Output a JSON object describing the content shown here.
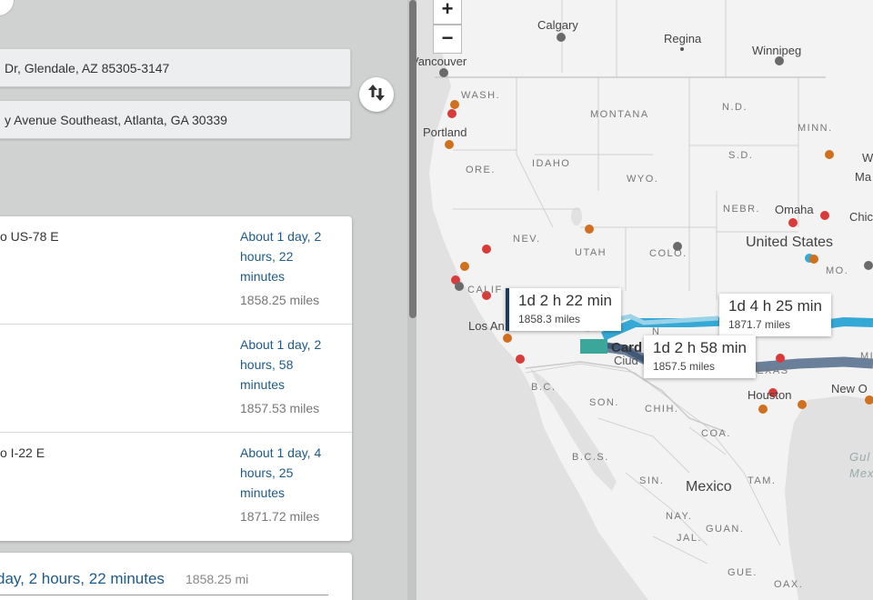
{
  "origin": {
    "value": "Dr, Glendale, AZ 85305-3147"
  },
  "destination": {
    "value": "y Avenue Southeast, Atlanta, GA 30339"
  },
  "routes": [
    {
      "name": "o US-78 E",
      "time": "About 1 day, 2 hours, 22 minutes",
      "distance": "1858.25 miles"
    },
    {
      "name": "",
      "time": "About 1 day, 2 hours, 58 minutes",
      "distance": "1857.53 miles"
    },
    {
      "name": "o I-22 E",
      "time": "About 1 day, 4 hours, 25 minutes",
      "distance": "1871.72 miles"
    }
  ],
  "summary": {
    "time": "day, 2 hours, 22 minutes",
    "distance": "1858.25 mi"
  },
  "zoom": {
    "in": "+",
    "out": "−"
  },
  "popups": [
    {
      "time": "1d 2 h 22 min",
      "distance": "1858.3 miles"
    },
    {
      "time": "1d 4 h 25 min",
      "distance": "1871.7 miles"
    },
    {
      "time": "1d 2 h 58 min",
      "distance": "1857.5 miles"
    }
  ],
  "map_labels": {
    "cities": [
      "Calgary",
      "Regina",
      "Winnipeg",
      "Vancouver",
      "Portland",
      "Omaha",
      "Chic",
      "Los An",
      "Houston",
      "New O",
      "Ma",
      "W"
    ],
    "regions": [
      "WASH.",
      "MONTANA",
      "N.D.",
      "MINN.",
      "ORE.",
      "IDAHO",
      "S.D.",
      "WYO.",
      "NEBR.",
      "NEV.",
      "UTAH",
      "COLO.",
      "MO.",
      "CALIF",
      "N",
      "TEXAS",
      "B.C.",
      "SON.",
      "CHIH.",
      "COA.",
      "B.C.S.",
      "SIN.",
      "TAM.",
      "NAY.",
      "GUAN.",
      "JAL.",
      "GUE.",
      "OAX.",
      "MI"
    ],
    "countries": [
      "United States",
      "Mexico"
    ],
    "water": [
      "Gul",
      "Mex"
    ],
    "marker_text": "Card",
    "marker_sub": "Ciud"
  },
  "colors": {
    "route_active": "#6a7f99",
    "route_alt": "#35a9d6",
    "marker_red": "#d93a3a",
    "marker_orange": "#d0701f",
    "marker_gray": "#6a6a6a"
  }
}
